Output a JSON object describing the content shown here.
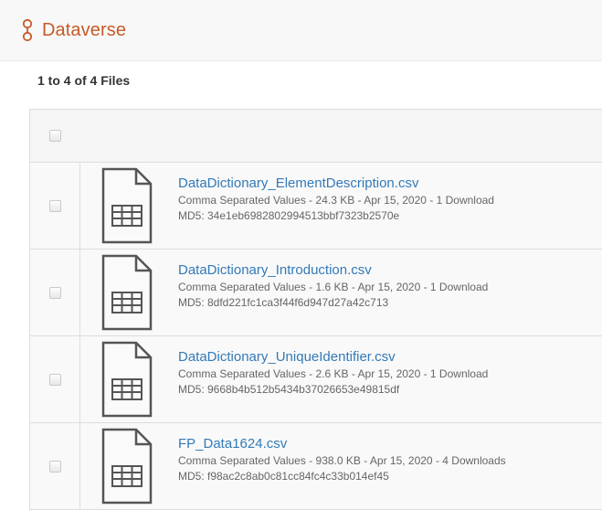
{
  "header": {
    "brand": "Dataverse",
    "brand_color": "#c55b28"
  },
  "files_count": "1 to 4 of 4 Files",
  "files": [
    {
      "name": "DataDictionary_ElementDescription.csv",
      "meta": "Comma Separated Values - 24.3 KB - Apr 15, 2020 - 1 Download",
      "md5": "MD5: 34e1eb6982802994513bbf7323b2570e"
    },
    {
      "name": "DataDictionary_Introduction.csv",
      "meta": "Comma Separated Values - 1.6 KB - Apr 15, 2020 - 1 Download",
      "md5": "MD5: 8dfd221fc1ca3f44f6d947d27a42c713"
    },
    {
      "name": "DataDictionary_UniqueIdentifier.csv",
      "meta": "Comma Separated Values - 2.6 KB - Apr 15, 2020 - 1 Download",
      "md5": "MD5: 9668b4b512b5434b37026653e49815df"
    },
    {
      "name": "FP_Data1624.csv",
      "meta": "Comma Separated Values - 938.0 KB - Apr 15, 2020 - 4 Downloads",
      "md5": "MD5: f98ac2c8ab0c81cc84fc4c33b014ef45"
    }
  ],
  "icons": {
    "brand": "dataverse-logo-icon",
    "file": "tabular-file-icon"
  },
  "colors": {
    "link": "#337ab7",
    "header_bg": "#f8f8f8",
    "row_bg": "#f9f9f9"
  }
}
